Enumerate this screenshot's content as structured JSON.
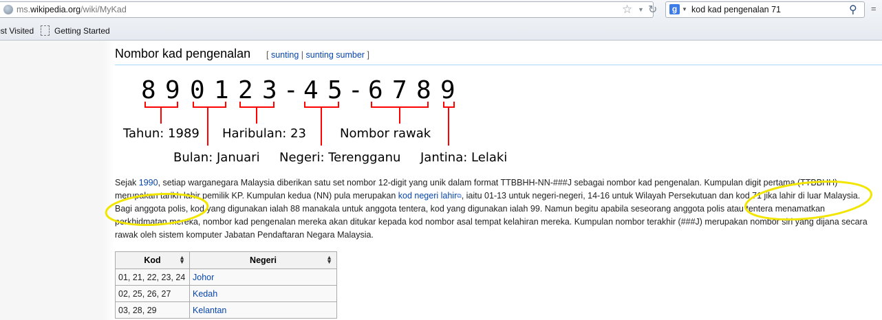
{
  "browser": {
    "url_prefix": "ms.",
    "url_domain": "wikipedia.org",
    "url_path": "/wiki/MyKad",
    "search_engine": "g",
    "search_text": "kod kad pengenalan 71",
    "menu_glyph": "="
  },
  "bookmarks": {
    "most_visited": "ost Visited",
    "getting_started": "Getting Started"
  },
  "section": {
    "heading": "Nombor kad pengenalan",
    "edit_open": "[",
    "edit_link": "sunting",
    "edit_sep": "|",
    "edit_source_link": "sunting sumber",
    "edit_close": "]"
  },
  "diagram": {
    "digits": [
      "8",
      "9",
      "0",
      "1",
      "2",
      "3",
      "-",
      "4",
      "5",
      "-",
      "6",
      "7",
      "8",
      "9"
    ],
    "labels": {
      "tahun": "Tahun: 1989",
      "haribulan": "Haribulan: 23",
      "nombor_rawak": "Nombor rawak",
      "bulan": "Bulan: Januari",
      "negeri": "Negeri: Terengganu",
      "jantina": "Jantina: Lelaki"
    },
    "bracket_color": "#ff0000"
  },
  "paragraph": {
    "t1": "Sejak ",
    "year_link": "1990",
    "t2": ", setiap warganegara Malaysia diberikan satu set nombor 12-digit yang unik dalam format TTBBHH-NN-###J sebagai nombor kad pengenalan. Kumpulan digit pertama (TTBBHH) merupakan tarikh lahir pemilik KP. Kumpulan kedua (NN) pula merupakan ",
    "kod_link": "kod negeri lahir",
    "t3": ", iaitu 01-13 untuk negeri-negeri, 14-16 untuk Wilayah Persekutuan dan kod 71 jika lahir di luar Malaysia. Bagi anggota polis, kod yang digunakan ialah 88 manakala untuk anggota tentera, kod yang digunakan ialah 99. Namun begitu apabila seseorang anggota polis atau tentera menamatkan perkhidmatan mereka, nombor kad pengenalan mereka akan ditukar kepada kod nombor asal tempat kelahiran mereka. Kumpulan nombor terakhir (###J) merupakan nombor siri yang dijana secara rawak oleh sistem komputer Jabatan Pendaftaran Negara Malaysia."
  },
  "table": {
    "headers": [
      "Kod",
      "Negeri"
    ],
    "rows": [
      {
        "kod": "01, 21, 22, 23, 24",
        "negeri": "Johor"
      },
      {
        "kod": "02, 25, 26, 27",
        "negeri": "Kedah"
      },
      {
        "kod": "03, 28, 29",
        "negeri": "Kelantan"
      }
    ]
  },
  "annotation": {
    "highlight_color": "#f2e600"
  }
}
